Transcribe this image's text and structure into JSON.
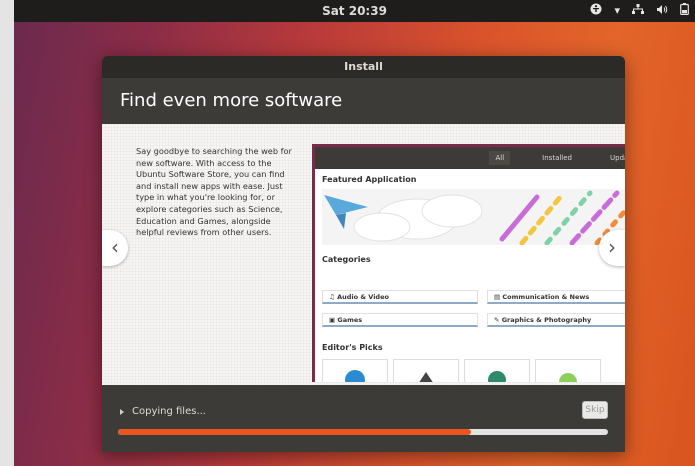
{
  "topbar": {
    "clock": "Sat 20:39",
    "icons": [
      "accessibility-icon",
      "chevron-down-icon",
      "network-icon",
      "volume-icon",
      "battery-icon"
    ]
  },
  "window": {
    "title": "Install",
    "heading": "Find even more software",
    "description": "Say goodbye to searching the web for new software. With access to the Ubuntu Software Store, you can find and install new apps with ease. Just type in what you're looking for, or explore categories such as Science, Education and Games, alongside helpful reviews from other users.",
    "prev_label": "‹",
    "next_label": "›",
    "software_store": {
      "tabs": [
        "All",
        "Installed",
        "Updates"
      ],
      "active_tab": "All",
      "featured_title": "Featured Application",
      "categories_title": "Categories",
      "categories": [
        "Audio & Video",
        "Communication & News",
        "Games",
        "Graphics & Photography"
      ],
      "editors_picks_title": "Editor's Picks"
    },
    "footer": {
      "status": "Copying files...",
      "skip_label": "Skip",
      "progress": 0.72
    }
  },
  "colors": {
    "accent": "#e95420",
    "header_bg": "#3c3b37",
    "topbar_bg": "#1f1d1b"
  }
}
